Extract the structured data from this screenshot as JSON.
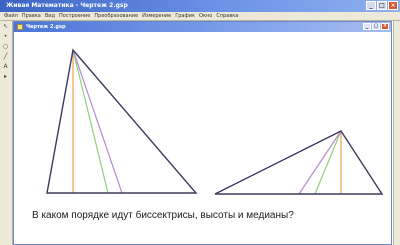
{
  "app": {
    "title": "Живая Математика - Чертеж 2.gsp",
    "min_glyph": "_",
    "max_glyph": "□",
    "close_glyph": "×"
  },
  "menu": {
    "items": [
      "Файл",
      "Правка",
      "Вид",
      "Построение",
      "Преобразование",
      "Измерение",
      "График",
      "Окно",
      "Справка"
    ]
  },
  "toolbar": {
    "tools": [
      "arrow-icon",
      "point-icon",
      "compass-icon",
      "line-icon",
      "text-icon",
      "custom-tool-icon"
    ],
    "glyphs": [
      "↖",
      "•",
      "○",
      "╱",
      "A",
      "▸"
    ]
  },
  "document": {
    "title": "Чертеж 2.gsp",
    "min_glyph": "_",
    "max_glyph": "□",
    "close_glyph": "×"
  },
  "colors": {
    "triangle": "#3a3a5e",
    "orange_segment": "#f0a24a",
    "green_segment": "#8ed17a",
    "purple_segment": "#b48ad6"
  },
  "question": "В каком порядке идут биссектрисы, высоты и медианы?"
}
